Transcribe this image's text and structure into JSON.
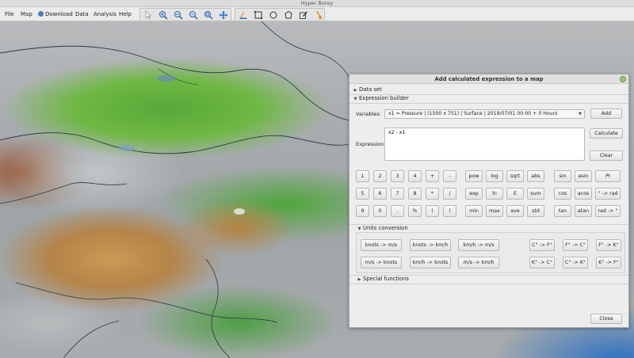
{
  "app": {
    "title": "Hyper Borey"
  },
  "menu": [
    {
      "label": "File"
    },
    {
      "label": "Map"
    },
    {
      "label": "Download",
      "icon": "download-icon"
    },
    {
      "label": "Data"
    },
    {
      "label": "Analysis"
    },
    {
      "label": "Help"
    }
  ],
  "toolbar": {
    "group1": [
      {
        "name": "pointer-tool",
        "icon": "pointer-icon"
      },
      {
        "name": "zoom-in-tool",
        "icon": "zoom-in-icon"
      },
      {
        "name": "zoom-out-tool",
        "icon": "zoom-out-icon"
      },
      {
        "name": "zoom-minus-tool",
        "icon": "zoom-minus-icon"
      },
      {
        "name": "zoom-fit-tool",
        "icon": "zoom-fit-icon"
      },
      {
        "name": "pan-tool",
        "icon": "move-arrows-icon"
      }
    ],
    "group2": [
      {
        "name": "measure-tool",
        "icon": "ruler-icon"
      },
      {
        "name": "rectangle-tool",
        "icon": "rectangle-select-icon"
      },
      {
        "name": "circle-tool",
        "icon": "circle-select-icon"
      },
      {
        "name": "polygon-tool",
        "icon": "polygon-select-icon"
      },
      {
        "name": "edit-tool",
        "icon": "edit-icon"
      },
      {
        "name": "brush-tool",
        "icon": "brush-icon"
      }
    ]
  },
  "dialog": {
    "title": "Add calculated expression to a map",
    "sections": {
      "dataset": "Data set",
      "builder": "Expression builder",
      "units": "Units conversion",
      "special": "Special functions"
    },
    "variables_label": "Variables:",
    "variables_value": "x1 = Pressure | (1500 x 751) | Surface | 2019/07/01 00:00 + 0 Hours",
    "expression_label": "Expression:",
    "expression_value": "x2 - x1",
    "add_label": "Add",
    "calculate_label": "Calculate",
    "clear_label": "Clear",
    "close_label": "Close",
    "keypad": [
      [
        "1",
        "2",
        "3",
        "4",
        "+",
        "-"
      ],
      [
        "5",
        "6",
        "7",
        "8",
        "*",
        "/"
      ],
      [
        "9",
        "0",
        ".",
        "%",
        "(",
        ")"
      ]
    ],
    "functions": [
      [
        "pow",
        "log",
        "sqrt",
        "abs"
      ],
      [
        "exp",
        "ln",
        "E",
        "sum"
      ],
      [
        "min",
        "max",
        "ave",
        "std"
      ]
    ],
    "trig": [
      [
        "sin",
        "asin",
        "PI"
      ],
      [
        "cos",
        "acos",
        "° -> rad"
      ],
      [
        "tan",
        "atan",
        "rad -> °"
      ]
    ],
    "speed_units": [
      [
        "knots -> m/s",
        "knots -> km/h",
        "km/h -> m/s"
      ],
      [
        "m/s -> knots",
        "km/h -> knots",
        "m/s -> km/h"
      ]
    ],
    "temp_units": [
      [
        "C° -> F°",
        "F° -> C°",
        "F° -> K°"
      ],
      [
        "K° -> C°",
        "C° -> K°",
        "K° -> F°"
      ]
    ]
  }
}
